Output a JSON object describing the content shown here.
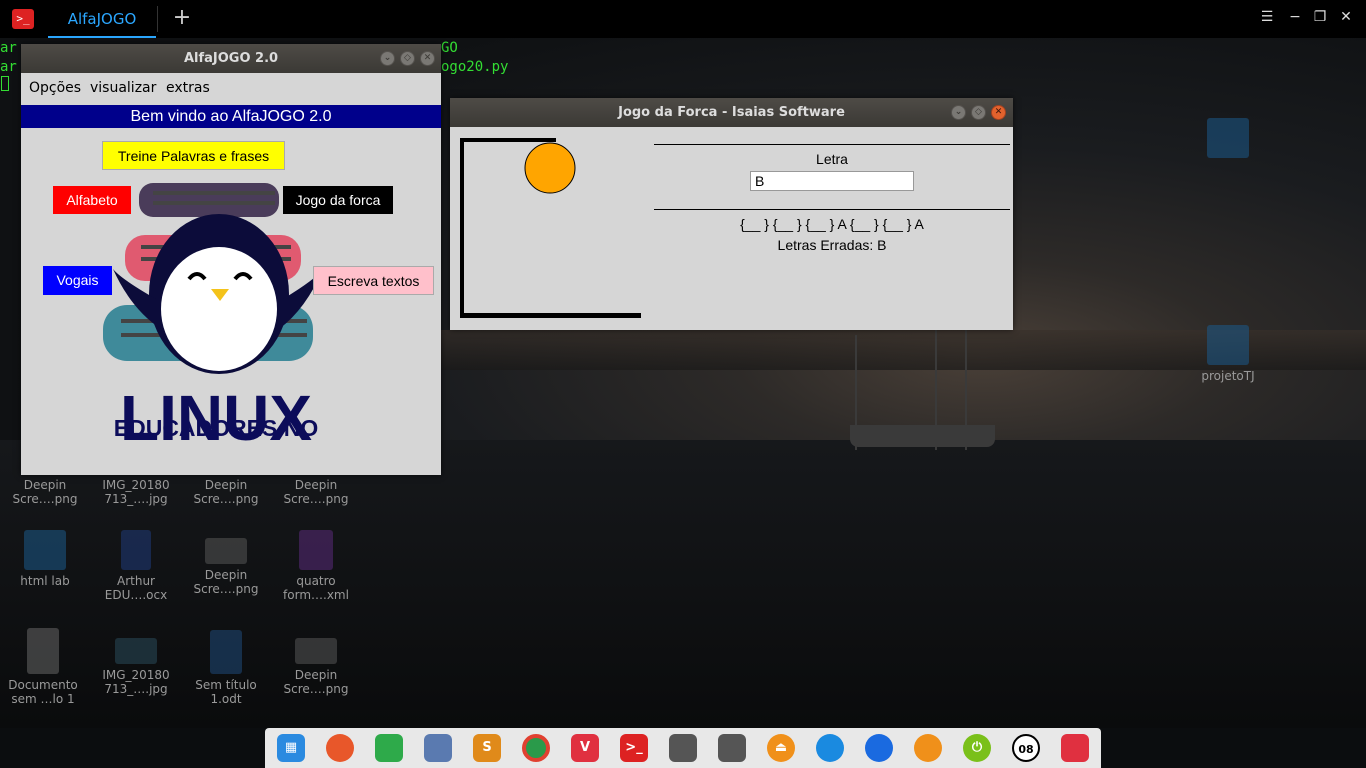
{
  "terminal": {
    "tab_title": "AlfaJOGO",
    "add_tab_symbol": "+",
    "icon_symbol": ">_",
    "controls": {
      "menu": "☰",
      "minimize": "−",
      "maximize": "❐",
      "close": "✕"
    },
    "lines": [
      {
        "left": "ar",
        "right": "GO"
      },
      {
        "left": "ar",
        "right": "ogo20.py"
      }
    ]
  },
  "desktop_icons": [
    {
      "name": "Deepin Scre….png",
      "line1": "Deepin",
      "line2": "Scre….png"
    },
    {
      "name": "IMG_20180713_….jpg",
      "line1": "IMG_20180",
      "line2": "713_….jpg"
    },
    {
      "name": "Deepin Scre….png",
      "line1": "Deepin",
      "line2": "Scre….png"
    },
    {
      "name": "Deepin Scre….png",
      "line1": "Deepin",
      "line2": "Scre….png"
    },
    {
      "name": "html lab",
      "line1": "html lab",
      "line2": ""
    },
    {
      "name": "Arthur EDU….ocx",
      "line1": "Arthur",
      "line2": "EDU….ocx"
    },
    {
      "name": "Deepin Scre….png",
      "line1": "Deepin",
      "line2": "Scre….png"
    },
    {
      "name": "quatro form….xml",
      "line1": "quatro",
      "line2": "form….xml"
    },
    {
      "name": "Documento sem …lo 1",
      "line1": "Documento",
      "line2": "sem …lo 1"
    },
    {
      "name": "IMG_20180713_….jpg",
      "line1": "IMG_20180",
      "line2": "713_….jpg"
    },
    {
      "name": "Sem título 1.odt",
      "line1": "Sem título",
      "line2": "1.odt"
    },
    {
      "name": "Deepin Scre….png",
      "line1": "Deepin",
      "line2": "Scre….png"
    },
    {
      "name": "projetoTJ",
      "line1": "projetoTJ",
      "line2": ""
    }
  ],
  "alfajogo_window": {
    "title": "AlfaJOGO 2.0",
    "menu": [
      "Opções",
      "visualizar",
      "extras"
    ],
    "banner": "Bem vindo ao AlfaJOGO 2.0",
    "buttons": {
      "treine": "Treine Palavras e frases",
      "alfabeto": "Alfabeto",
      "jogo_forca": "Jogo da forca",
      "vogais": "Vogais",
      "escreva": "Escreva textos"
    },
    "logo": {
      "line1": "EDUCADORES NO",
      "line2": "LINUX"
    }
  },
  "forca_window": {
    "title": "Jogo da Forca - Isaias Software",
    "letra_label": "Letra",
    "letra_value": "B",
    "word_display": "{__ } {__ } {__ } A {__ } {__ } A",
    "wrong_letters": "Letras Erradas:  B"
  },
  "colors": {
    "banner": "#00008b",
    "treine_button": "#ffff00",
    "alfabeto_button": "#ff0000",
    "jogo_forca_button": "#000000",
    "vogais_button": "#0000ff",
    "escreva_button": "#ffc0cb",
    "hangman_head": "#ffa500",
    "tab_accent": "#2ba7ff"
  },
  "dock": {
    "items": [
      "launcher-icon",
      "firefox-icon",
      "app-store-icon",
      "file-manager-icon",
      "sublime-icon",
      "chrome-icon",
      "vivaldi-icon",
      "terminal-icon",
      "document-icon",
      "document-icon",
      "eject-icon",
      "wifi-icon",
      "dropbox-icon",
      "pidgin-icon",
      "power-icon",
      "clock-icon",
      "trash-icon"
    ],
    "clock_text": "08"
  }
}
